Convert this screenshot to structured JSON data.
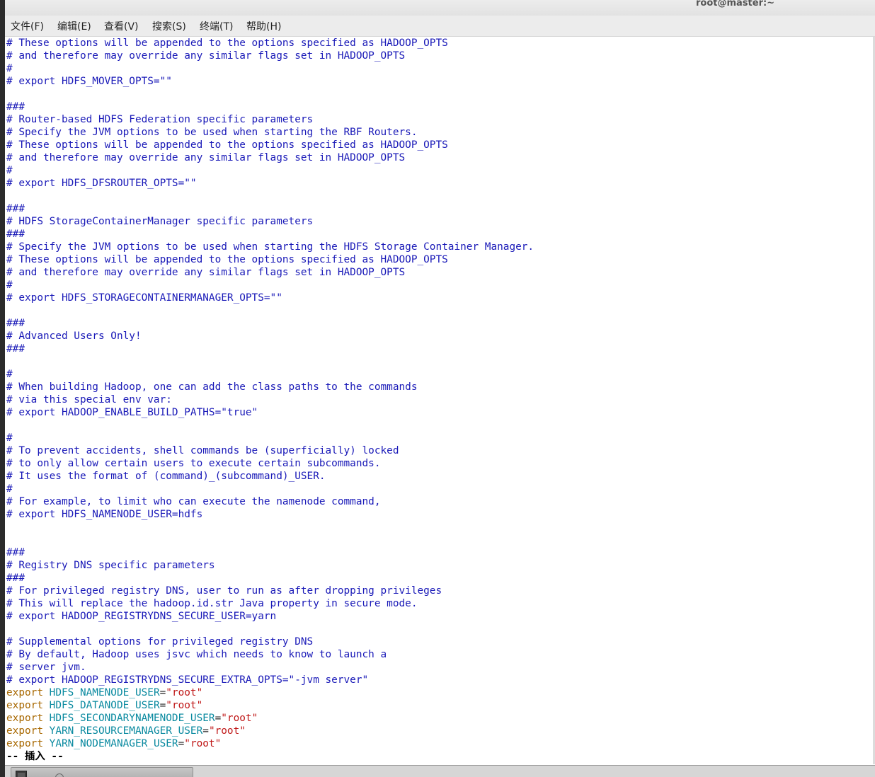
{
  "window": {
    "title": "root@master:~"
  },
  "menu": [
    "文件(F)",
    "编辑(E)",
    "查看(V)",
    "搜索(S)",
    "终端(T)",
    "帮助(H)"
  ],
  "terminal": {
    "lines": [
      "# These options will be appended to the options specified as HADOOP_OPTS",
      "# and therefore may override any similar flags set in HADOOP_OPTS",
      "#",
      "# export HDFS_MOVER_OPTS=\"\"",
      "",
      "###",
      "# Router-based HDFS Federation specific parameters",
      "# Specify the JVM options to be used when starting the RBF Routers.",
      "# These options will be appended to the options specified as HADOOP_OPTS",
      "# and therefore may override any similar flags set in HADOOP_OPTS",
      "#",
      "# export HDFS_DFSROUTER_OPTS=\"\"",
      "",
      "###",
      "# HDFS StorageContainerManager specific parameters",
      "###",
      "# Specify the JVM options to be used when starting the HDFS Storage Container Manager.",
      "# These options will be appended to the options specified as HADOOP_OPTS",
      "# and therefore may override any similar flags set in HADOOP_OPTS",
      "#",
      "# export HDFS_STORAGECONTAINERMANAGER_OPTS=\"\"",
      "",
      "###",
      "# Advanced Users Only!",
      "###",
      "",
      "#",
      "# When building Hadoop, one can add the class paths to the commands",
      "# via this special env var:",
      "# export HADOOP_ENABLE_BUILD_PATHS=\"true\"",
      "",
      "#",
      "# To prevent accidents, shell commands be (superficially) locked",
      "# to only allow certain users to execute certain subcommands.",
      "# It uses the format of (command)_(subcommand)_USER.",
      "#",
      "# For example, to limit who can execute the namenode command,",
      "# export HDFS_NAMENODE_USER=hdfs",
      "",
      "",
      "###",
      "# Registry DNS specific parameters",
      "###",
      "# For privileged registry DNS, user to run as after dropping privileges",
      "# This will replace the hadoop.id.str Java property in secure mode.",
      "# export HADOOP_REGISTRYDNS_SECURE_USER=yarn",
      "",
      "# Supplemental options for privileged registry DNS",
      "# By default, Hadoop uses jsvc which needs to know to launch a",
      "# server jvm.",
      "# export HADOOP_REGISTRYDNS_SECURE_EXTRA_OPTS=\"-jvm server\""
    ],
    "exports": [
      {
        "keyword": "export",
        "name": "HDFS_NAMENODE_USER",
        "op": "=",
        "value": "\"root\""
      },
      {
        "keyword": "export",
        "name": "HDFS_DATANODE_USER",
        "op": "=",
        "value": "\"root\""
      },
      {
        "keyword": "export",
        "name": "HDFS_SECONDARYNAMENODE_USER",
        "op": "=",
        "value": "\"root\""
      },
      {
        "keyword": "export",
        "name": "YARN_RESOURCEMANAGER_USER",
        "op": "=",
        "value": "\"root\""
      },
      {
        "keyword": "export",
        "name": "YARN_NODEMANAGER_USER",
        "op": "=",
        "value": "\"root\""
      }
    ],
    "mode_line": "-- 插入 --"
  },
  "colors": {
    "comment": "#1a1ab8",
    "keyword": "#a86800",
    "identifier": "#0a8aa0",
    "string": "#c01818"
  },
  "taskbar": {
    "icons": [
      "terminal-icon"
    ]
  }
}
